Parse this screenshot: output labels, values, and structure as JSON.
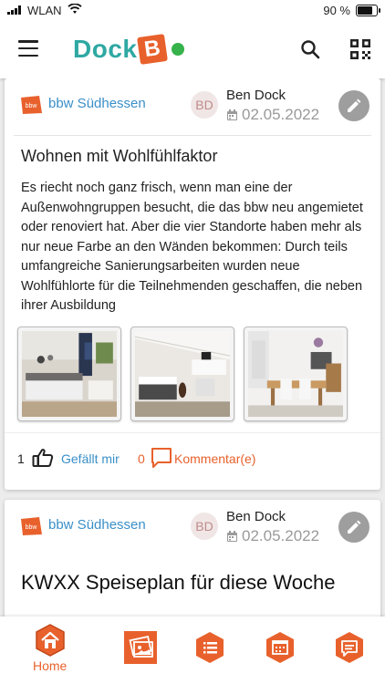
{
  "status": {
    "network": "WLAN",
    "battery": "90 %",
    "battery_level": 0.9
  },
  "app": {
    "logo_text": "Dock",
    "logo_letter": "B",
    "menu_icon": "hamburger-menu-icon",
    "search_icon": "search-icon",
    "qr_icon": "qr-code-icon"
  },
  "colors": {
    "brand_orange": "#e8612c",
    "brand_teal": "#2fa8a3",
    "online_green": "#36b24a",
    "link_blue": "#3a8fc8"
  },
  "posts": [
    {
      "org": "bbw Südhessen",
      "avatar": "BD",
      "author": "Ben Dock",
      "date": "02.05.2022",
      "title": "Wohnen mit Wohlfühlfaktor",
      "body": "Es riecht noch ganz frisch, wenn man eine der Außenwohngruppen besucht, die das bbw neu angemietet oder renoviert hat. Aber die vier Standorte haben mehr als nur neue Farbe an den Wänden bekommen: Durch teils umfangreiche Sanierungsarbeiten wurden neue Wohlfühlorte für die Teilnehmenden geschaffen, die neben ihrer Ausbildung",
      "likes": "1",
      "like_label": "Gefällt mir",
      "comments": "0",
      "comment_label": "Kommentar(e)"
    },
    {
      "org": "bbw Südhessen",
      "avatar": "BD",
      "author": "Ben Dock",
      "date": "02.05.2022",
      "title": "KWXX Speiseplan für diese Woche"
    }
  ],
  "nav": {
    "home_label": "Home"
  }
}
